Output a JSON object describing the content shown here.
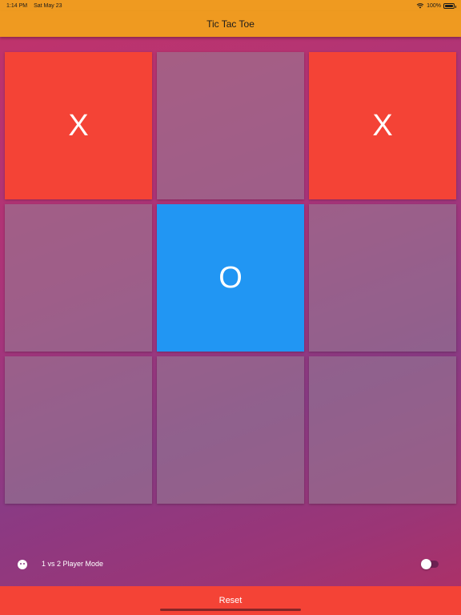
{
  "status": {
    "time": "1:14 PM",
    "date": "Sat May 23",
    "battery": "100%"
  },
  "app": {
    "title": "Tic Tac Toe"
  },
  "board": {
    "cells": [
      "X",
      "",
      "X",
      "",
      "O",
      "",
      "",
      "",
      ""
    ]
  },
  "mode": {
    "label": "1 vs 2 Player Mode",
    "toggle_on": false
  },
  "reset": {
    "label": "Reset"
  },
  "colors": {
    "appbar": "#ef9a20",
    "x_cell": "#f44336",
    "o_cell": "#2196f3",
    "reset": "#f44336"
  },
  "icons": {
    "wifi": "wifi-icon",
    "battery": "battery-icon",
    "mode": "face-icon"
  }
}
